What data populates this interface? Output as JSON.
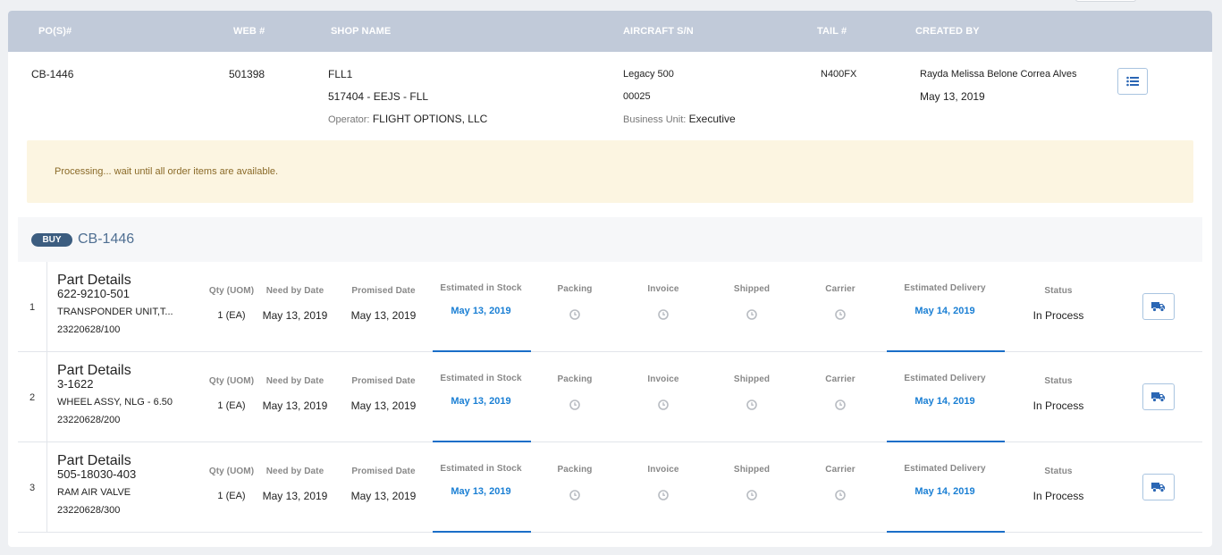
{
  "header": {
    "cols": {
      "pos": "PO(S)#",
      "web": "WEB #",
      "shop": "SHOP NAME",
      "aircraft": "AIRCRAFT S/N",
      "tail": "TAIL #",
      "created": "CREATED BY"
    }
  },
  "order": {
    "po": "CB-1446",
    "web": "501398",
    "shop_name": "FLL1",
    "shop_code": "517404 - EEJS - FLL",
    "operator_label": "Operator:",
    "operator": "FLIGHT OPTIONS, LLC",
    "aircraft": "Legacy 500",
    "aircraft_sn": "00025",
    "bu_label": "Business Unit:",
    "bu": "Executive",
    "tail": "N400FX",
    "created_by": "Rayda Melissa Belone Correa Alves",
    "created_date": "May 13, 2019"
  },
  "alert": {
    "text": "Processing... wait until all order items are available."
  },
  "section": {
    "badge": "BUY",
    "title": "CB-1446"
  },
  "labels": {
    "part_details": "Part Details",
    "qty": "Qty (UOM)",
    "need_by": "Need by Date",
    "promised": "Promised Date",
    "est_stock": "Estimated in Stock",
    "packing": "Packing",
    "invoice": "Invoice",
    "shipped": "Shipped",
    "carrier": "Carrier",
    "est_delivery": "Estimated Delivery",
    "status": "Status"
  },
  "items": [
    {
      "index": "1",
      "part_number": "622-9210-501",
      "description": "TRANSPONDER UNIT,T...",
      "ref": "23220628/100",
      "qty": "1 (EA)",
      "need_by": "May 13, 2019",
      "promised": "May 13, 2019",
      "est_stock": "May 13, 2019",
      "est_delivery": "May 14, 2019",
      "status": "In Process"
    },
    {
      "index": "2",
      "part_number": "3-1622",
      "description": "WHEEL ASSY, NLG - 6.50",
      "ref": "23220628/200",
      "qty": "1 (EA)",
      "need_by": "May 13, 2019",
      "promised": "May 13, 2019",
      "est_stock": "May 13, 2019",
      "est_delivery": "May 14, 2019",
      "status": "In Process"
    },
    {
      "index": "3",
      "part_number": "505-18030-403",
      "description": "RAM AIR VALVE",
      "ref": "23220628/300",
      "qty": "1 (EA)",
      "need_by": "May 13, 2019",
      "promised": "May 13, 2019",
      "est_stock": "May 13, 2019",
      "est_delivery": "May 14, 2019",
      "status": "In Process"
    }
  ],
  "colors": {
    "header_bg": "#c1cad9",
    "accent_blue": "#1a7fd4",
    "badge": "#3c5d80",
    "alert_bg": "#fcf5e1"
  },
  "icons": {
    "list": "list-icon",
    "truck": "truck-icon",
    "clock": "clock-icon"
  }
}
